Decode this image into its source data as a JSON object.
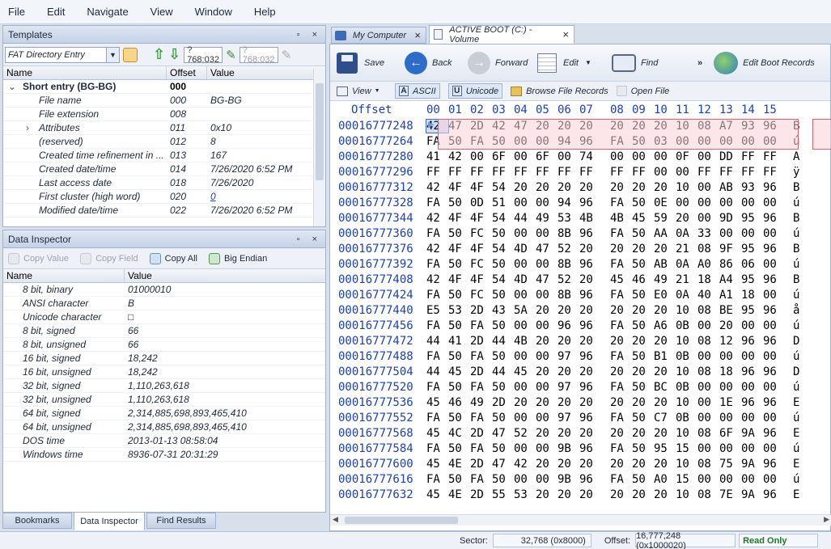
{
  "menu": [
    "File",
    "Edit",
    "Navigate",
    "View",
    "Window",
    "Help"
  ],
  "templates": {
    "title": "Templates",
    "controls": "▫ ×",
    "template_name": "FAT Directory Entry",
    "offset_value_1": "?768:032",
    "offset_value_2": "?768:032",
    "columns": [
      "Name",
      "Offset",
      "Value"
    ],
    "rows": [
      {
        "name": "Short entry (BG-BG)",
        "offset": "000",
        "value": "",
        "bold": true,
        "indent": 0,
        "expander": "v"
      },
      {
        "name": "File name",
        "offset": "000",
        "value": "BG-BG",
        "indent": 1
      },
      {
        "name": "File extension",
        "offset": "008",
        "value": "",
        "indent": 1
      },
      {
        "name": "Attributes",
        "offset": "011",
        "value": "0x10",
        "indent": 1,
        "expander": ">"
      },
      {
        "name": "(reserved)",
        "offset": "012",
        "value": "8",
        "indent": 1
      },
      {
        "name": "Created time refinement in ...",
        "offset": "013",
        "value": "167",
        "indent": 1
      },
      {
        "name": "Created date/time",
        "offset": "014",
        "value": "7/26/2020 6:52 PM",
        "indent": 1
      },
      {
        "name": "Last access date",
        "offset": "018",
        "value": "7/26/2020",
        "indent": 1
      },
      {
        "name": "First cluster (high word)",
        "offset": "020",
        "value": "0",
        "indent": 1,
        "link": true
      },
      {
        "name": "Modified date/time",
        "offset": "022",
        "value": "7/26/2020 6:52 PM",
        "indent": 1
      }
    ]
  },
  "inspector": {
    "title": "Data Inspector",
    "controls": "▫ ×",
    "buttons": {
      "copy_value": "Copy Value",
      "copy_field": "Copy Field",
      "copy_all": "Copy All",
      "endian": "Big Endian"
    },
    "columns": [
      "Name",
      "Value"
    ],
    "rows": [
      {
        "name": "8 bit, binary",
        "value": "01000010"
      },
      {
        "name": "ANSI character",
        "value": "B"
      },
      {
        "name": "Unicode character",
        "value": "□"
      },
      {
        "name": "8 bit, signed",
        "value": "66"
      },
      {
        "name": "8 bit, unsigned",
        "value": "66"
      },
      {
        "name": "16 bit, signed",
        "value": "18,242"
      },
      {
        "name": "16 bit, unsigned",
        "value": "18,242"
      },
      {
        "name": "32 bit, signed",
        "value": "1,110,263,618"
      },
      {
        "name": "32 bit, unsigned",
        "value": "1,110,263,618"
      },
      {
        "name": "64 bit, signed",
        "value": "2,314,885,698,893,465,410"
      },
      {
        "name": "64 bit, unsigned",
        "value": "2,314,885,698,893,465,410"
      },
      {
        "name": "DOS time",
        "value": "2013-01-13 08:58:04"
      },
      {
        "name": "Windows time",
        "value": "8936-07-31 20:31:29"
      }
    ]
  },
  "bottom_tabs": [
    "Bookmarks",
    "Data Inspector",
    "Find Results"
  ],
  "doc_tabs": [
    {
      "label": "My Computer",
      "close": "×"
    },
    {
      "label": "ACTIVE BOOT (C:) - Volume",
      "close": "×"
    }
  ],
  "main_toolbar": {
    "save": "Save",
    "back": "Back",
    "forward": "Forward",
    "edit": "Edit",
    "find": "Find",
    "more": "»",
    "edit_boot": "Edit Boot Records"
  },
  "sub_toolbar": {
    "view": "View",
    "ascii": "ASCII",
    "unicode": "Unicode",
    "browse": "Browse File Records",
    "open": "Open File"
  },
  "hex": {
    "offset_header": "Offset",
    "col_headers": [
      "00",
      "01",
      "02",
      "03",
      "04",
      "05",
      "06",
      "07",
      "08",
      "09",
      "10",
      "11",
      "12",
      "13",
      "14",
      "15"
    ],
    "rows": [
      {
        "offset": "00016777248",
        "bytes": [
          "42",
          "47",
          "2D",
          "42",
          "47",
          "20",
          "20",
          "20",
          "20",
          "20",
          "20",
          "10",
          "08",
          "A7",
          "93",
          "96"
        ],
        "ascii": "B"
      },
      {
        "offset": "00016777264",
        "bytes": [
          "FA",
          "50",
          "FA",
          "50",
          "00",
          "00",
          "94",
          "96",
          "FA",
          "50",
          "03",
          "00",
          "00",
          "00",
          "00",
          "00"
        ],
        "ascii": "ú"
      },
      {
        "offset": "00016777280",
        "bytes": [
          "41",
          "42",
          "00",
          "6F",
          "00",
          "6F",
          "00",
          "74",
          "00",
          "00",
          "00",
          "0F",
          "00",
          "DD",
          "FF",
          "FF"
        ],
        "ascii": "A"
      },
      {
        "offset": "00016777296",
        "bytes": [
          "FF",
          "FF",
          "FF",
          "FF",
          "FF",
          "FF",
          "FF",
          "FF",
          "FF",
          "FF",
          "00",
          "00",
          "FF",
          "FF",
          "FF",
          "FF"
        ],
        "ascii": "ÿ"
      },
      {
        "offset": "00016777312",
        "bytes": [
          "42",
          "4F",
          "4F",
          "54",
          "20",
          "20",
          "20",
          "20",
          "20",
          "20",
          "20",
          "10",
          "00",
          "AB",
          "93",
          "96"
        ],
        "ascii": "B"
      },
      {
        "offset": "00016777328",
        "bytes": [
          "FA",
          "50",
          "0D",
          "51",
          "00",
          "00",
          "94",
          "96",
          "FA",
          "50",
          "0E",
          "00",
          "00",
          "00",
          "00",
          "00"
        ],
        "ascii": "ú"
      },
      {
        "offset": "00016777344",
        "bytes": [
          "42",
          "4F",
          "4F",
          "54",
          "44",
          "49",
          "53",
          "4B",
          "4B",
          "45",
          "59",
          "20",
          "00",
          "9D",
          "95",
          "96"
        ],
        "ascii": "B"
      },
      {
        "offset": "00016777360",
        "bytes": [
          "FA",
          "50",
          "FC",
          "50",
          "00",
          "00",
          "8B",
          "96",
          "FA",
          "50",
          "AA",
          "0A",
          "33",
          "00",
          "00",
          "00"
        ],
        "ascii": "ú"
      },
      {
        "offset": "00016777376",
        "bytes": [
          "42",
          "4F",
          "4F",
          "54",
          "4D",
          "47",
          "52",
          "20",
          "20",
          "20",
          "20",
          "21",
          "08",
          "9F",
          "95",
          "96"
        ],
        "ascii": "B"
      },
      {
        "offset": "00016777392",
        "bytes": [
          "FA",
          "50",
          "FC",
          "50",
          "00",
          "00",
          "8B",
          "96",
          "FA",
          "50",
          "AB",
          "0A",
          "A0",
          "86",
          "06",
          "00"
        ],
        "ascii": "ú"
      },
      {
        "offset": "00016777408",
        "bytes": [
          "42",
          "4F",
          "4F",
          "54",
          "4D",
          "47",
          "52",
          "20",
          "45",
          "46",
          "49",
          "21",
          "18",
          "A4",
          "95",
          "96"
        ],
        "ascii": "B"
      },
      {
        "offset": "00016777424",
        "bytes": [
          "FA",
          "50",
          "FC",
          "50",
          "00",
          "00",
          "8B",
          "96",
          "FA",
          "50",
          "E0",
          "0A",
          "40",
          "A1",
          "18",
          "00"
        ],
        "ascii": "ú"
      },
      {
        "offset": "00016777440",
        "bytes": [
          "E5",
          "53",
          "2D",
          "43",
          "5A",
          "20",
          "20",
          "20",
          "20",
          "20",
          "20",
          "10",
          "08",
          "BE",
          "95",
          "96"
        ],
        "ascii": "å"
      },
      {
        "offset": "00016777456",
        "bytes": [
          "FA",
          "50",
          "FA",
          "50",
          "00",
          "00",
          "96",
          "96",
          "FA",
          "50",
          "A6",
          "0B",
          "00",
          "20",
          "00",
          "00"
        ],
        "ascii": "ú"
      },
      {
        "offset": "00016777472",
        "bytes": [
          "44",
          "41",
          "2D",
          "44",
          "4B",
          "20",
          "20",
          "20",
          "20",
          "20",
          "20",
          "10",
          "08",
          "12",
          "96",
          "96"
        ],
        "ascii": "D"
      },
      {
        "offset": "00016777488",
        "bytes": [
          "FA",
          "50",
          "FA",
          "50",
          "00",
          "00",
          "97",
          "96",
          "FA",
          "50",
          "B1",
          "0B",
          "00",
          "00",
          "00",
          "00"
        ],
        "ascii": "ú"
      },
      {
        "offset": "00016777504",
        "bytes": [
          "44",
          "45",
          "2D",
          "44",
          "45",
          "20",
          "20",
          "20",
          "20",
          "20",
          "20",
          "10",
          "08",
          "18",
          "96",
          "96"
        ],
        "ascii": "D"
      },
      {
        "offset": "00016777520",
        "bytes": [
          "FA",
          "50",
          "FA",
          "50",
          "00",
          "00",
          "97",
          "96",
          "FA",
          "50",
          "BC",
          "0B",
          "00",
          "00",
          "00",
          "00"
        ],
        "ascii": "ú"
      },
      {
        "offset": "00016777536",
        "bytes": [
          "45",
          "46",
          "49",
          "2D",
          "20",
          "20",
          "20",
          "20",
          "20",
          "20",
          "20",
          "10",
          "00",
          "1E",
          "96",
          "96"
        ],
        "ascii": "E"
      },
      {
        "offset": "00016777552",
        "bytes": [
          "FA",
          "50",
          "FA",
          "50",
          "00",
          "00",
          "97",
          "96",
          "FA",
          "50",
          "C7",
          "0B",
          "00",
          "00",
          "00",
          "00"
        ],
        "ascii": "ú"
      },
      {
        "offset": "00016777568",
        "bytes": [
          "45",
          "4C",
          "2D",
          "47",
          "52",
          "20",
          "20",
          "20",
          "20",
          "20",
          "20",
          "10",
          "08",
          "6F",
          "9A",
          "96"
        ],
        "ascii": "E"
      },
      {
        "offset": "00016777584",
        "bytes": [
          "FA",
          "50",
          "FA",
          "50",
          "00",
          "00",
          "9B",
          "96",
          "FA",
          "50",
          "95",
          "15",
          "00",
          "00",
          "00",
          "00"
        ],
        "ascii": "ú"
      },
      {
        "offset": "00016777600",
        "bytes": [
          "45",
          "4E",
          "2D",
          "47",
          "42",
          "20",
          "20",
          "20",
          "20",
          "20",
          "20",
          "10",
          "08",
          "75",
          "9A",
          "96"
        ],
        "ascii": "E"
      },
      {
        "offset": "00016777616",
        "bytes": [
          "FA",
          "50",
          "FA",
          "50",
          "00",
          "00",
          "9B",
          "96",
          "FA",
          "50",
          "A0",
          "15",
          "00",
          "00",
          "00",
          "00"
        ],
        "ascii": "ú"
      },
      {
        "offset": "00016777632",
        "bytes": [
          "45",
          "4E",
          "2D",
          "55",
          "53",
          "20",
          "20",
          "20",
          "20",
          "20",
          "20",
          "10",
          "08",
          "7E",
          "9A",
          "96"
        ],
        "ascii": "E"
      }
    ]
  },
  "status": {
    "sector_label": "Sector:",
    "sector_value": "32,768 (0x8000)",
    "offset_label": "Offset:",
    "offset_value": "16,777,248 (0x1000020)",
    "mode": "Read Only"
  },
  "colors": {
    "offset_blue": "#1a3fbf",
    "selection_fill": "#fbe3e6",
    "selection_border": "#d9646f",
    "readonly_green": "#1e7a2a"
  }
}
